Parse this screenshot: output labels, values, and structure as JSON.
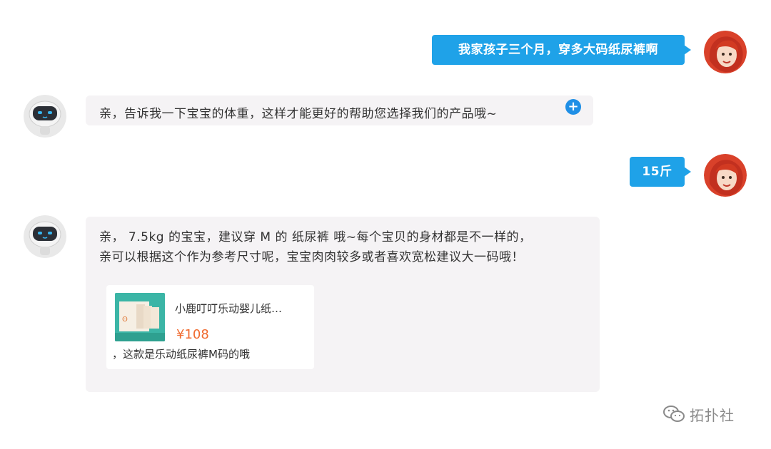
{
  "messages": [
    {
      "sender": "user",
      "text": "我家孩子三个月，穿多大码纸尿裤啊"
    },
    {
      "sender": "bot",
      "text": "亲，告诉我一下宝宝的体重，这样才能更好的帮助您选择我们的产品哦~"
    },
    {
      "sender": "user",
      "text": "15斤"
    },
    {
      "sender": "bot",
      "lines": [
        "亲， 7.5kg 的宝宝，建议穿 M 的 纸尿裤 哦~每个宝贝的身材都是不一样的，",
        "亲可以根据这个作为参考尺寸呢，宝宝肉肉较多或者喜欢宽松建议大一码哦！"
      ]
    }
  ],
  "product_card": {
    "title": "小鹿叮叮乐动婴儿纸…",
    "price": "¥108",
    "note": "，这款是乐动纸尿裤M码的哦"
  },
  "add_button": {
    "icon": "plus-icon",
    "label": "+"
  },
  "watermark": {
    "text": "拓扑社",
    "icon": "wechat-icon"
  },
  "colors": {
    "user_bubble": "#1fa2e8",
    "bot_bubble": "#f5f3f5",
    "price": "#f06a2f",
    "add_button": "#1f8fe6"
  }
}
